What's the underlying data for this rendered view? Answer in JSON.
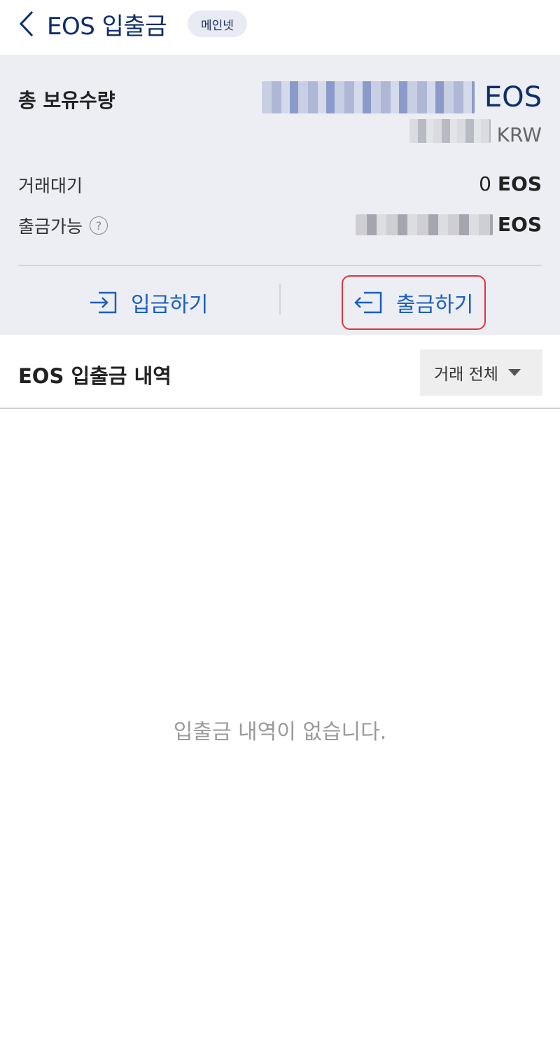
{
  "header": {
    "title": "EOS 입출금",
    "badge": "메인넷"
  },
  "summary": {
    "total_label": "총 보유수량",
    "total_unit": "EOS",
    "krw_unit": "KRW",
    "pending_label": "거래대기",
    "pending_amount": "0",
    "pending_unit": "EOS",
    "available_label": "출금가능",
    "available_unit": "EOS",
    "help_symbol": "?"
  },
  "actions": {
    "deposit_label": "입금하기",
    "withdraw_label": "출금하기"
  },
  "history": {
    "title": "EOS 입출금 내역",
    "filter_label": "거래 전체",
    "empty_message": "입출금 내역이 없습니다."
  },
  "colors": {
    "primary_navy": "#0d2d6b",
    "action_blue": "#1a5ebd",
    "highlight_red": "#e2333a",
    "panel_bg": "#eceef4"
  }
}
